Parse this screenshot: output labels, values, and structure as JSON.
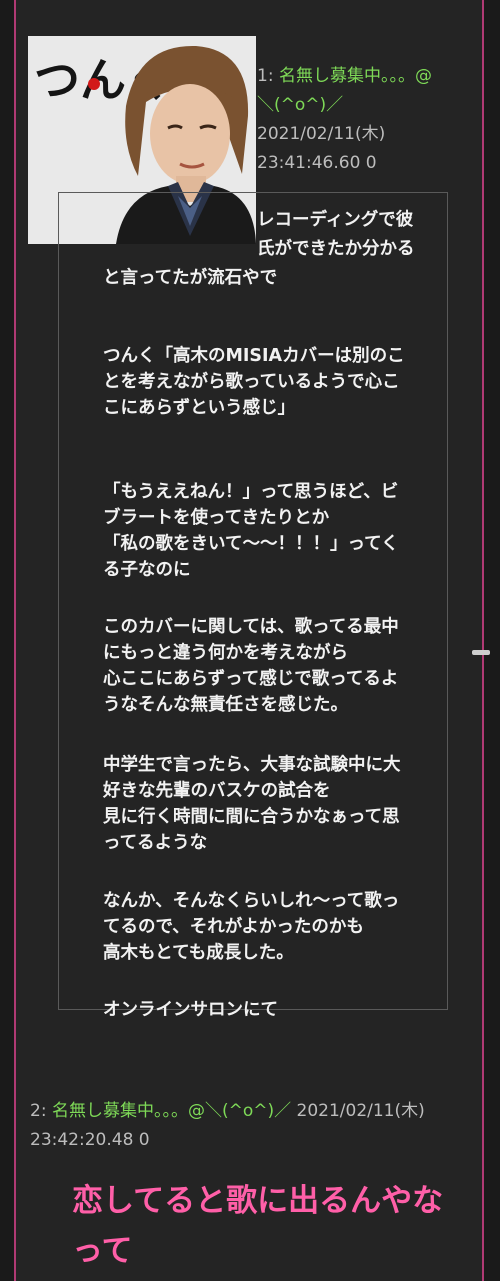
{
  "post1": {
    "number": "1:",
    "name": "名無し募集中。。。@",
    "name2": "＼(^o^)／",
    "date": "2021/02/11(木)",
    "time": "23:41:46.60 0"
  },
  "avatar": {
    "logo_text": "つんく",
    "icon": "profile-photo-icon"
  },
  "body": {
    "para1_line1": "レコーディングで彼",
    "para1_line2": "氏ができたか分かる",
    "para1_line3": "と言ってたが流石やで",
    "para2": "つんく「高木のMISIAカバーは別のこ\nとを考えながら歌っているようで心こ\nこにあらずという感じ」",
    "para3": "「もうええねん！」って思うほど、ビ\nブラートを使ってきたりとか\n「私の歌をきいて〜〜！！！」ってく\nる子なのに",
    "para4": "このカバーに関しては、歌ってる最中\nにもっと違う何かを考えながら\n心ここにあらずって感じで歌ってるよ\nうなそんな無責任さを感じた。",
    "para5": "中学生で言ったら、大事な試験中に大\n好きな先輩のバスケの試合を\n見に行く時間に間に合うかなぁって思\nってるような",
    "para6": "なんか、そんなくらいしれ〜って歌っ\nてるので、それがよかったのかも\n高木もとても成長した。",
    "para7": "オンラインサロンにて"
  },
  "post2": {
    "number": "2:",
    "name": "名無し募集中。。。@＼(^o^)／",
    "date": "2021/02/11(木)",
    "time": "23:42:20.48 0",
    "text": "恋してると歌に出るんやな\nって"
  },
  "colors": {
    "name": "#7ed957",
    "accent_pink": "#ff5fa8",
    "border": "#b03a74"
  }
}
